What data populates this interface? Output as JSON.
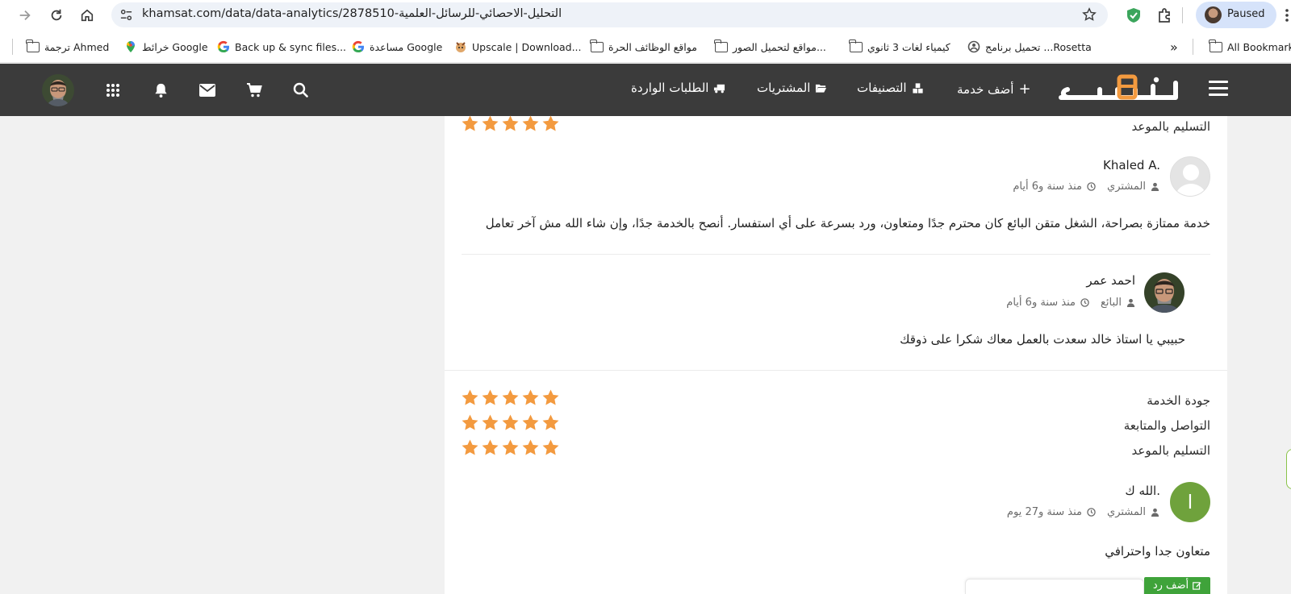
{
  "browser": {
    "url": "khamsat.com/data/data-analytics/2878510-التحليل-الاحصائي-للرسائل-العلمية",
    "profile_label": "Paused",
    "bookmarks": [
      {
        "label": "ترجمة Ahmed",
        "icon": "folder-icon"
      },
      {
        "label": "خرائط Google",
        "icon": "maps-pin-icon"
      },
      {
        "label": "Back up & sync files...",
        "icon": "google-g-icon"
      },
      {
        "label": "مساعدة Google",
        "icon": "google-g-icon"
      },
      {
        "label": "Upscale | Download...",
        "icon": "upscale-icon"
      },
      {
        "label": "مواقع الوظائف الحرة",
        "icon": "folder-icon"
      },
      {
        "label": "مواقع لتحميل الصور...",
        "icon": "folder-icon"
      },
      {
        "label": "كيمياء لغات 3 ثانوي",
        "icon": "folder-icon"
      },
      {
        "label": "تحميل برنامج ...Rosetta",
        "icon": "rosetta-icon"
      }
    ],
    "bookmarks_overflow": "»",
    "all_bookmarks": "All Bookmarks"
  },
  "site": {
    "nav": {
      "add_service": "أضف خدمة",
      "categories": "التصنيفات",
      "purchases": "المشتريات",
      "incoming_orders": "الطلبات الواردة"
    }
  },
  "ratings_top": {
    "delivery_label": "التسليم بالموعد",
    "stars": 5
  },
  "review1": {
    "name": "Khaled A.",
    "role": "المشتري",
    "time": "منذ سنة و6 أيام",
    "text": "خدمة ممتازة بصراحة، الشغل متقن البائع كان محترم جدًا ومتعاون، ورد بسرعة على أي استفسار. أنصح بالخدمة جدًا، وإن شاء الله مش آخر تعامل"
  },
  "reply1": {
    "name": "احمد عمر",
    "role": "البائع",
    "time": "منذ سنة و6 أيام",
    "text": "حبيبي يا استاذ خالد سعدت بالعمل معاك شكرا على ذوقك"
  },
  "ratings2": {
    "quality_label": "جودة الخدمة",
    "communication_label": "التواصل والمتابعة",
    "delivery_label": "التسليم بالموعد",
    "quality_stars": 5,
    "communication_stars": 5,
    "delivery_stars": 5
  },
  "review2": {
    "avatar_letter": "ا",
    "name": "الله ك.",
    "role": "المشتري",
    "time": "منذ سنة و27 يوم",
    "text": "متعاون جدا واحترافي"
  },
  "actions": {
    "add_reply": "أضف رد"
  },
  "colors": {
    "header_bg": "#3b3b3b",
    "star": "#f39a3f",
    "reply_button": "#3fa33a",
    "letter_avatar": "#6fa23c"
  }
}
